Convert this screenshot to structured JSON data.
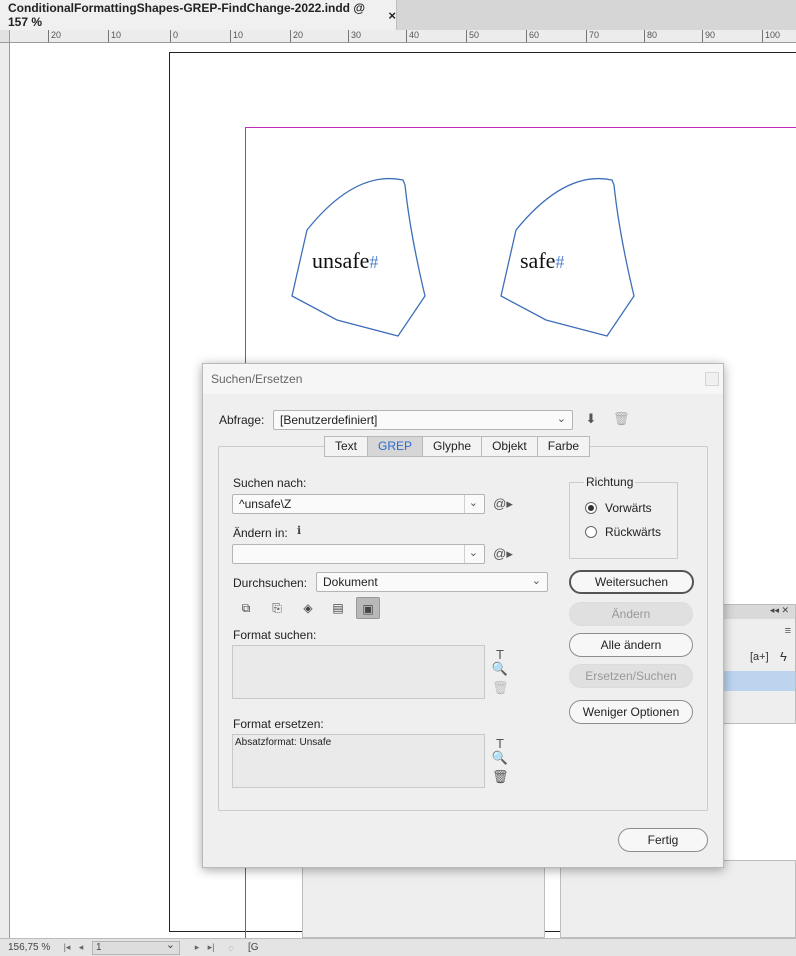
{
  "document_tab": {
    "title": "ConditionalFormattingShapes-GREP-FindChange-2022.indd @ 157 %",
    "close": "×"
  },
  "ruler": {
    "labels": [
      "20",
      "10",
      "0",
      "10",
      "20",
      "30",
      "40",
      "50",
      "60",
      "70",
      "80",
      "90",
      "100"
    ]
  },
  "canvas": {
    "shapes": [
      {
        "text": "unsafe",
        "marker": "#"
      },
      {
        "text": "safe",
        "marker": "#"
      }
    ]
  },
  "background_panel": {
    "label": "[a+]"
  },
  "statusbar": {
    "zoom": "156,75 %",
    "page": "1",
    "extra": "[G"
  },
  "dialog": {
    "title": "Suchen/Ersetzen",
    "query_label": "Abfrage:",
    "query_value": "[Benutzerdefiniert]",
    "tabs": [
      "Text",
      "GREP",
      "Glyphe",
      "Objekt",
      "Farbe"
    ],
    "active_tab": "GREP",
    "search_label": "Suchen nach:",
    "search_value": "^unsafe\\Z",
    "change_label": "Ändern in:",
    "change_value": "",
    "scope_label": "Durchsuchen:",
    "scope_value": "Dokument",
    "direction_label": "Richtung",
    "direction_forward": "Vorwärts",
    "direction_backward": "Rückwärts",
    "find_format_label": "Format suchen:",
    "find_format_value": "",
    "change_format_label": "Format ersetzen:",
    "change_format_value": "Absatzformat: Unsafe",
    "buttons": {
      "find_next": "Weitersuchen",
      "change": "Ändern",
      "change_all": "Alle ändern",
      "change_find": "Ersetzen/Suchen",
      "fewer_options": "Weniger Optionen",
      "done": "Fertig"
    }
  }
}
